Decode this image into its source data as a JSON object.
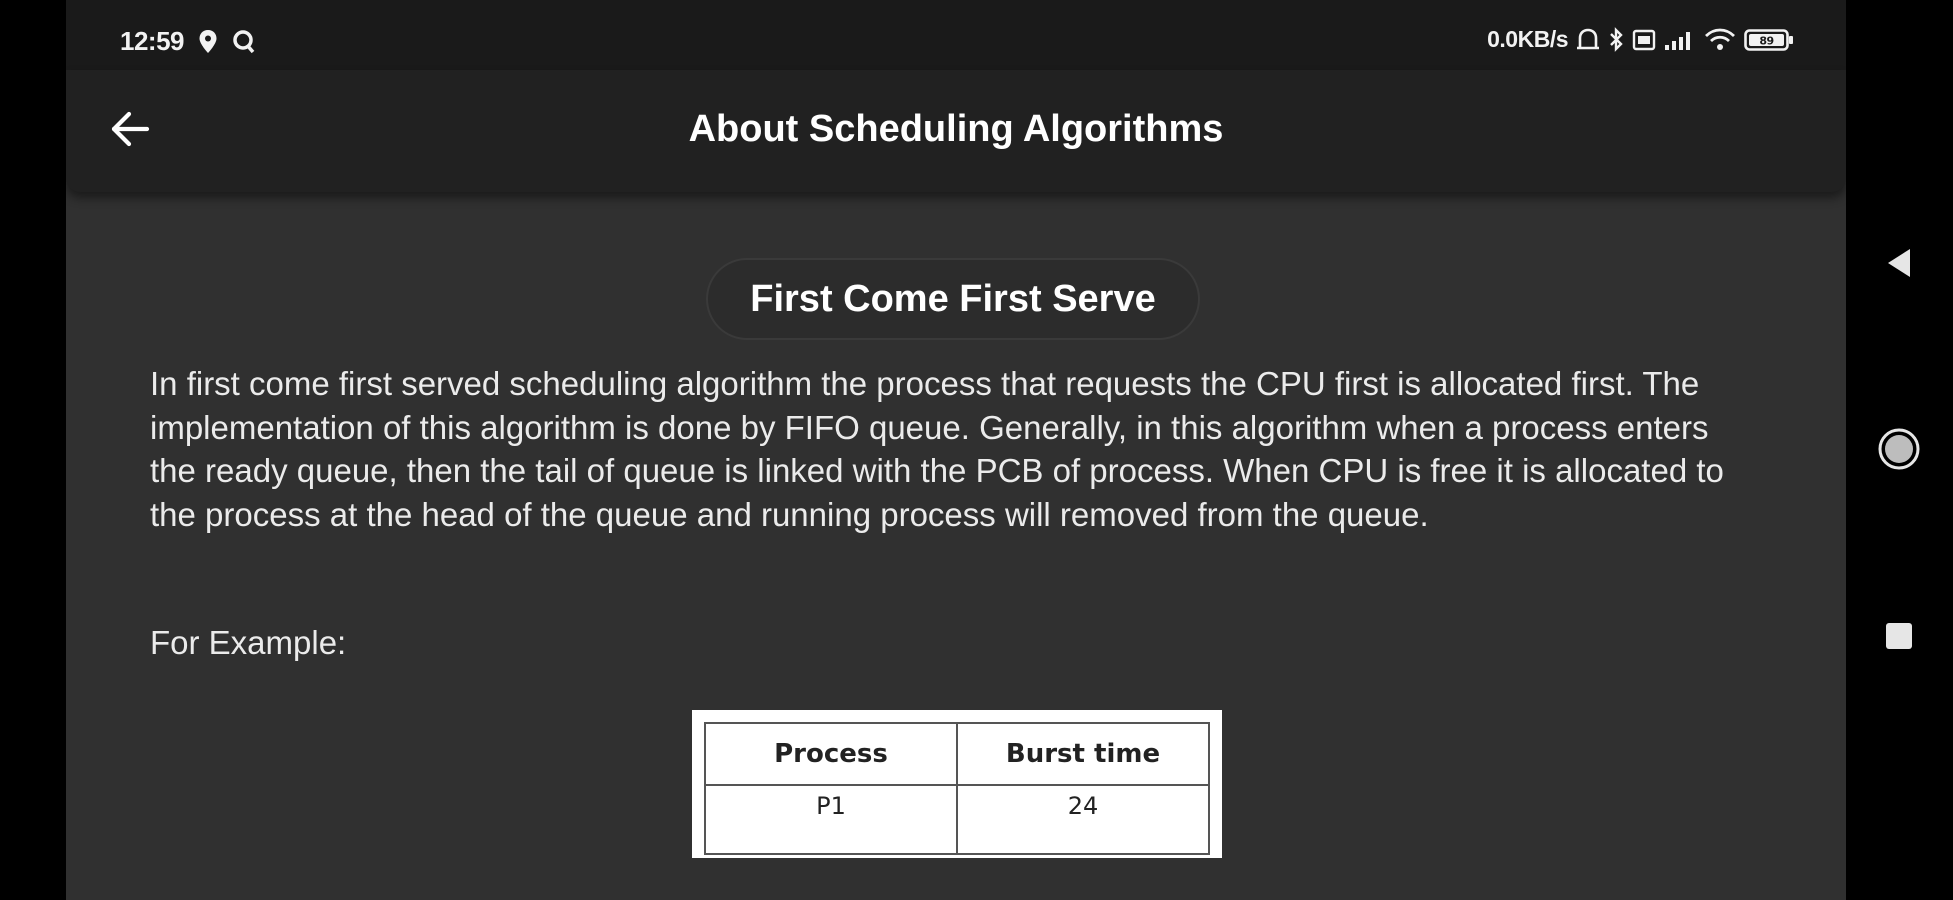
{
  "status_bar": {
    "time": "12:59",
    "network_speed": "0.0KB/s",
    "battery_level": "89",
    "icons_left": [
      "location-pin-icon",
      "q-app-icon"
    ],
    "icons_right": [
      "bell-icon",
      "bluetooth-icon",
      "sim-icon",
      "signal-icon",
      "wifi-icon",
      "battery-icon"
    ]
  },
  "app_bar": {
    "title": "About Scheduling Algorithms",
    "back_icon": "arrow-left-icon"
  },
  "content": {
    "section_title": "First Come First Serve",
    "description": "In first come first served scheduling algorithm the process that requests the CPU first is allocated first. The implementation of this algorithm is done by FIFO queue. Generally, in this algorithm when a process enters the ready queue, then the tail of queue is linked with the PCB of process. When CPU is free it is allocated to the process at the head of the queue and running process will removed from the queue.",
    "example_label": "For Example:",
    "table": {
      "headers": [
        "Process",
        "Burst time"
      ],
      "rows": [
        [
          "P1",
          "24"
        ]
      ]
    }
  },
  "nav_bar": {
    "buttons": [
      "back-triangle-icon",
      "home-circle-icon",
      "recents-square-icon"
    ]
  },
  "colors": {
    "background": "#303030",
    "app_bar": "#212121",
    "status_bar": "#1a1a1a",
    "text": "#ebebeb"
  }
}
